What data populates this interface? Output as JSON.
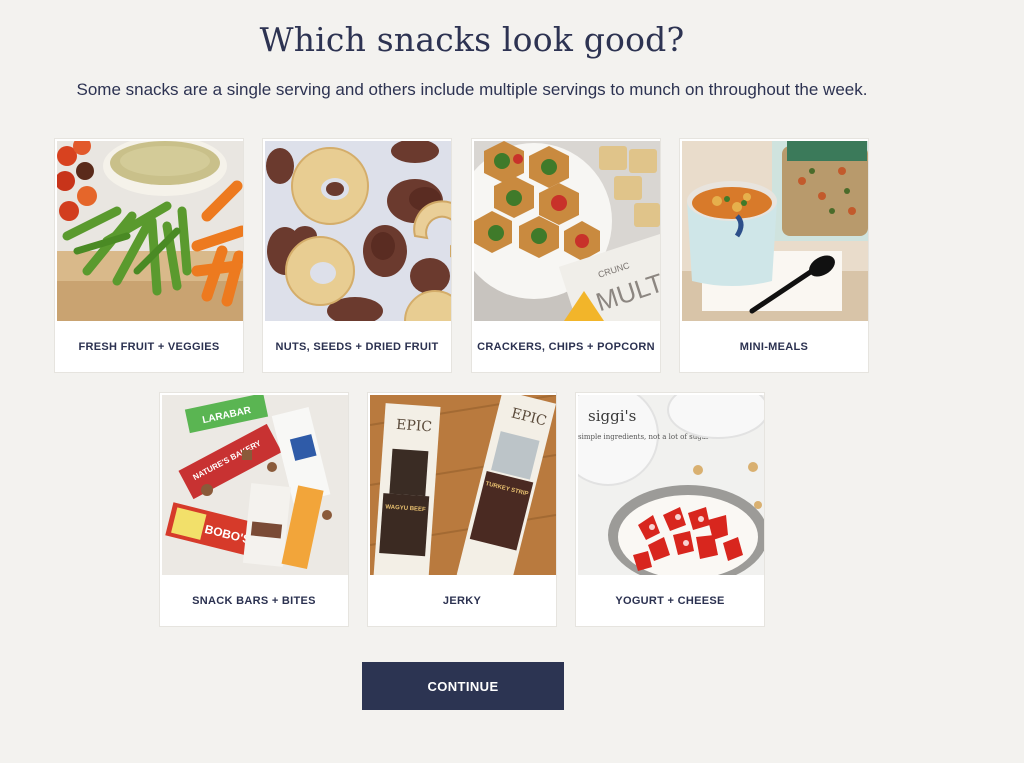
{
  "page": {
    "title": "Which snacks look good?",
    "subtitle": "Some snacks are a single serving and others include multiple servings to munch on throughout the week."
  },
  "categories": [
    {
      "label": "FRESH FRUIT + VEGGIES",
      "icon": "veggie-tray-photo"
    },
    {
      "label": "NUTS, SEEDS + DRIED FRUIT",
      "icon": "dried-fruit-photo"
    },
    {
      "label": "CRACKERS, CHIPS + POPCORN",
      "icon": "crackers-photo"
    },
    {
      "label": "MINI-MEALS",
      "icon": "soup-cup-photo"
    },
    {
      "label": "SNACK BARS + BITES",
      "icon": "snack-bars-photo"
    },
    {
      "label": "JERKY",
      "icon": "jerky-photo"
    },
    {
      "label": "YOGURT + CHEESE",
      "icon": "yogurt-photo"
    }
  ],
  "product_text": {
    "crackers_bag": "CRUNC",
    "crackers_bag_big": "MULT",
    "bar_brand": "LARABAR",
    "bar_bakery": "NATURE'S BAKERY",
    "bar_bobos": "BOBO'S",
    "jerky_brand": "EPIC",
    "jerky_left": "WAGYU BEEF",
    "jerky_right": "TURKEY STRIP",
    "yogurt_brand": "siggi's",
    "yogurt_line": "simple ingredients, not a lot of sugar"
  },
  "actions": {
    "continue_label": "CONTINUE"
  },
  "colors": {
    "background": "#f3f2ef",
    "navy": "#2c3452",
    "card": "#ffffff"
  }
}
